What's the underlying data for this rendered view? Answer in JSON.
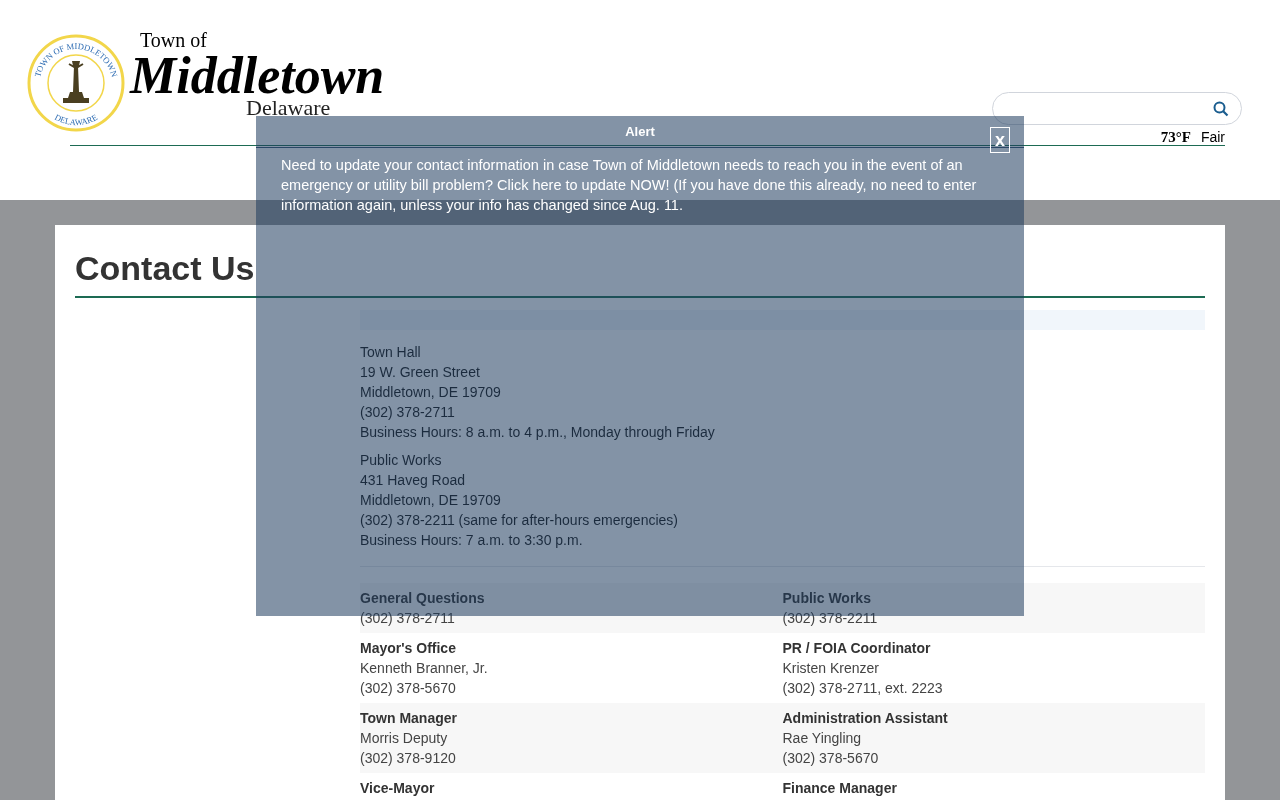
{
  "header": {
    "seal_top": "TOWN OF MIDDLETOWN",
    "seal_bottom": "DELAWARE",
    "logo_small": "Town of",
    "logo_main": "Middletown",
    "logo_sub": "Delaware",
    "weather": {
      "temperature": "73°F",
      "condition": "Fair"
    }
  },
  "page": {
    "title": "Contact Us",
    "locations": [
      {
        "lines": [
          "Town Hall",
          "19 W. Green Street",
          "Middletown, DE 19709",
          "(302) 378-2711",
          "Business Hours: 8 a.m. to 4 p.m., Monday through Friday"
        ]
      },
      {
        "lines": [
          "Public Works",
          "431 Haveg Road",
          "Middletown, DE 19709",
          "(302) 378-2211 (same for after-hours emergencies)",
          "Business Hours: 7 a.m. to 3:30 p.m."
        ]
      }
    ],
    "contacts": [
      [
        {
          "title": "General Questions",
          "lines": [
            "(302) 378-2711"
          ]
        },
        {
          "title": "Public Works",
          "lines": [
            "(302) 378-2211"
          ]
        }
      ],
      [
        {
          "title": "Mayor's Office",
          "lines": [
            "Kenneth Branner, Jr.",
            "(302) 378-5670"
          ]
        },
        {
          "title": "PR / FOIA Coordinator",
          "lines": [
            "Kristen Krenzer",
            "(302) 378-2711, ext. 2223"
          ]
        }
      ],
      [
        {
          "title": "Town Manager",
          "lines": [
            "Morris Deputy",
            "(302) 378-9120"
          ]
        },
        {
          "title": "Administration Assistant",
          "lines": [
            "Rae Yingling",
            "(302) 378-5670"
          ]
        }
      ],
      [
        {
          "title": "Vice-Mayor"
        },
        {
          "title": "Finance Manager"
        }
      ]
    ]
  },
  "alert": {
    "title": "Alert",
    "close": "x",
    "message": "Need to update your contact information in case Town of Middletown needs to reach you in the event of an emergency or utility bill problem? Click here to update NOW! (If you have done this already, no need to enter information again, unless your info has changed since Aug. 11."
  }
}
